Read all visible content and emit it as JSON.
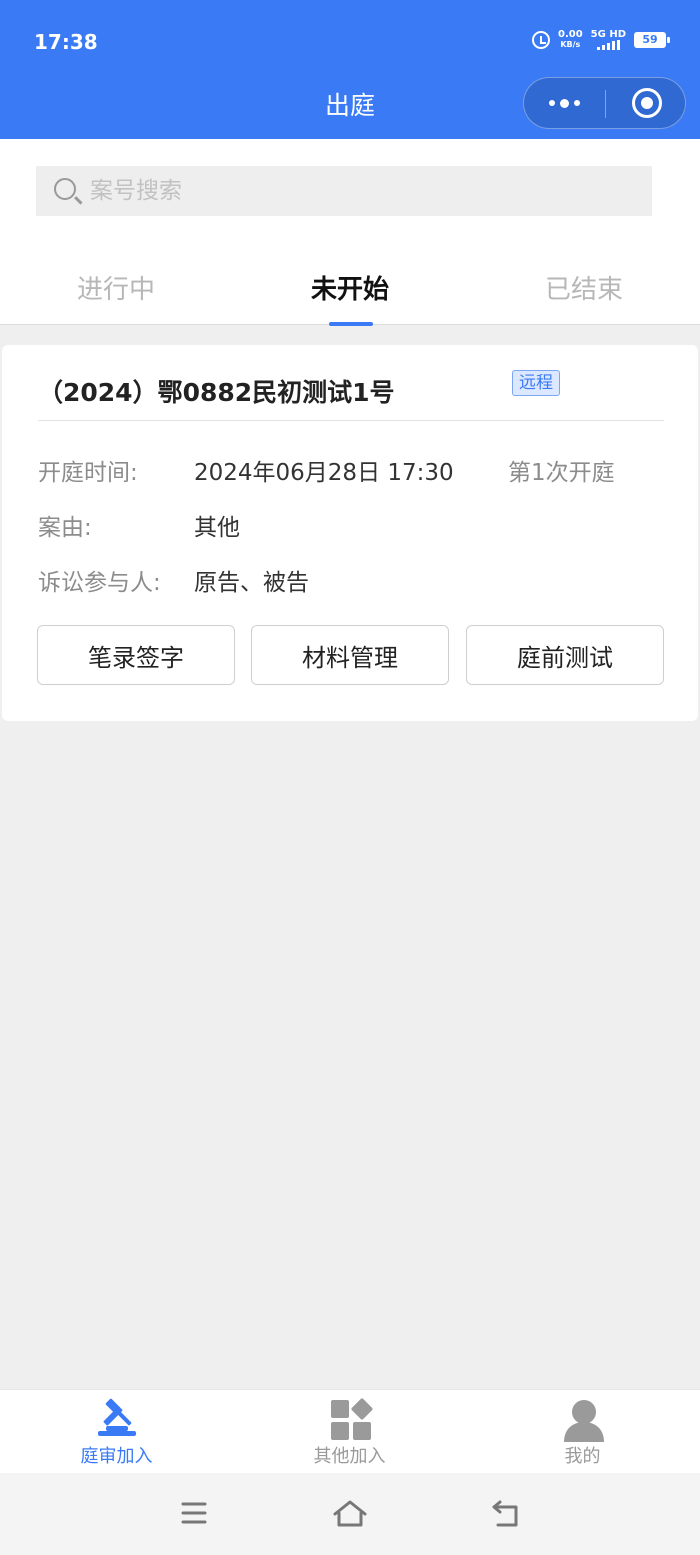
{
  "status_bar": {
    "time": "17:38",
    "net_speed": "0.00",
    "net_unit": "KB/s",
    "network": "5G HD",
    "battery": "59"
  },
  "nav": {
    "title": "出庭"
  },
  "search": {
    "placeholder": "案号搜索"
  },
  "tabs": [
    {
      "label": "进行中",
      "active": false
    },
    {
      "label": "未开始",
      "active": true
    },
    {
      "label": "已结束",
      "active": false
    }
  ],
  "case_card": {
    "title": "（2024）鄂0882民初测试1号",
    "badge": "远程",
    "rows": [
      {
        "label": "开庭时间:",
        "value": "2024年06月28日 17:30",
        "extra": "第1次开庭"
      },
      {
        "label": "案由:",
        "value": "其他"
      },
      {
        "label": "诉讼参与人:",
        "value": "原告、被告"
      }
    ],
    "buttons": [
      "笔录签字",
      "材料管理",
      "庭前测试"
    ]
  },
  "tabbar": [
    {
      "label": "庭审加入",
      "icon": "gavel-icon",
      "active": true
    },
    {
      "label": "其他加入",
      "icon": "apps-icon",
      "active": false
    },
    {
      "label": "我的",
      "icon": "user-icon",
      "active": false
    }
  ],
  "colors": {
    "primary": "#3a7bf5",
    "page_bg": "#efefef"
  }
}
